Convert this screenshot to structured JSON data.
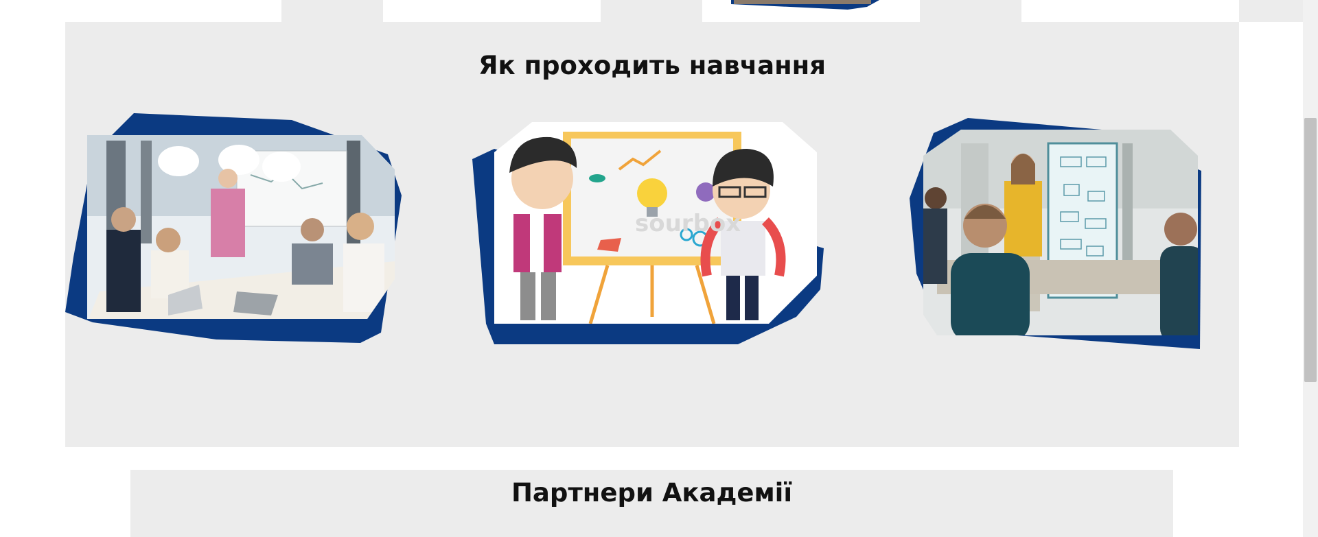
{
  "how_section": {
    "title": "Як проходить навчання",
    "images": [
      {
        "icon": "meeting-photo",
        "description_name": "business-meeting-whiteboard"
      },
      {
        "icon": "cartoon-presentation",
        "watermark": "sourbox"
      },
      {
        "icon": "meeting-photo",
        "description_name": "presenter-at-flipchart"
      }
    ]
  },
  "partners_section": {
    "title": "Партнери Академії"
  },
  "colors": {
    "section_bg": "#ececec",
    "frame_blue": "#0b3a82",
    "title_text": "#111111"
  }
}
